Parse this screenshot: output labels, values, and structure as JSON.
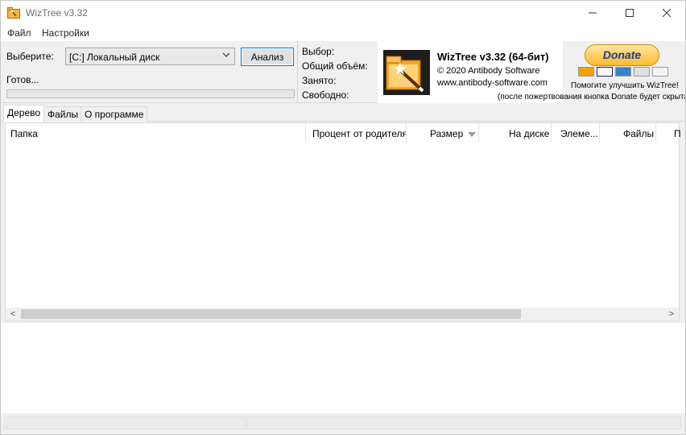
{
  "window": {
    "title": "WizTree v3.32"
  },
  "menu": {
    "file": "Файл",
    "settings": "Настройки"
  },
  "scan": {
    "select_label": "Выберите:",
    "drive_value": "[C:] Локальный диск",
    "analyze_label": "Анализ",
    "status": "Готов...",
    "progress": 0
  },
  "info": {
    "selection": "Выбор:",
    "total": "Общий объём:",
    "used": "Занято:",
    "free": "Свободно:"
  },
  "brand": {
    "title": "WizTree v3.32 (64-бит)",
    "copyright": "© 2020 Antibody Software",
    "site": "www.antibody-software.com"
  },
  "donate": {
    "button": "Donate",
    "help": "Помогите улучшить WizTree!",
    "note": "(после пожертвования кнопка Donate будет скрыта)"
  },
  "tabs": [
    "Дерево",
    "Файлы",
    "О программе"
  ],
  "table": {
    "columns": [
      "Папка",
      "Процент от родителя",
      "Размер",
      "На диске",
      "Элеме...",
      "Файлы",
      "П"
    ],
    "sort_column": "Размер",
    "scroll_left": "<",
    "scroll_right": ">"
  },
  "colors": {
    "accent": "#0078d7",
    "donate_gold": "#ffb92f",
    "progress_green": "#06b025"
  }
}
